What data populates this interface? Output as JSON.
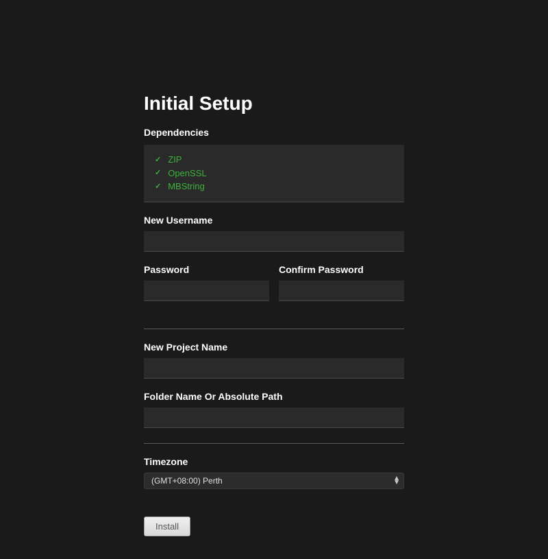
{
  "title": "Initial Setup",
  "dependencies": {
    "label": "Dependencies",
    "items": [
      {
        "name": "ZIP",
        "ok": true
      },
      {
        "name": "OpenSSL",
        "ok": true
      },
      {
        "name": "MBString",
        "ok": true
      }
    ]
  },
  "fields": {
    "username": {
      "label": "New Username",
      "value": ""
    },
    "password": {
      "label": "Password",
      "value": ""
    },
    "confirmPassword": {
      "label": "Confirm Password",
      "value": ""
    },
    "projectName": {
      "label": "New Project Name",
      "value": ""
    },
    "folderPath": {
      "label": "Folder Name Or Absolute Path",
      "value": ""
    },
    "timezone": {
      "label": "Timezone",
      "selected": "(GMT+08:00) Perth"
    }
  },
  "button": {
    "install": "Install"
  }
}
